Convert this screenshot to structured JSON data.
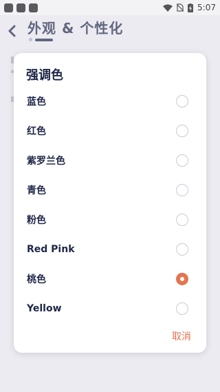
{
  "status_bar": {
    "time": "5:07",
    "icons": [
      "wifi-icon",
      "no-sim-icon",
      "battery-charging-icon"
    ],
    "notification_icons": 3
  },
  "header": {
    "title": "外观 & 个性化",
    "back_icon": "chevron-left-icon"
  },
  "dialog": {
    "title": "强调色",
    "options": [
      {
        "label": "蓝色",
        "selected": false
      },
      {
        "label": "红色",
        "selected": false
      },
      {
        "label": "紫罗兰色",
        "selected": false
      },
      {
        "label": "青色",
        "selected": false
      },
      {
        "label": "粉色",
        "selected": false
      },
      {
        "label": "Red Pink",
        "selected": false
      },
      {
        "label": "桃色",
        "selected": true
      },
      {
        "label": "Yellow",
        "selected": false
      }
    ],
    "cancel_label": "取消"
  },
  "colors": {
    "accent": "#e4744f",
    "title_text": "#1f2748",
    "radio_border": "#c9cbd6"
  }
}
